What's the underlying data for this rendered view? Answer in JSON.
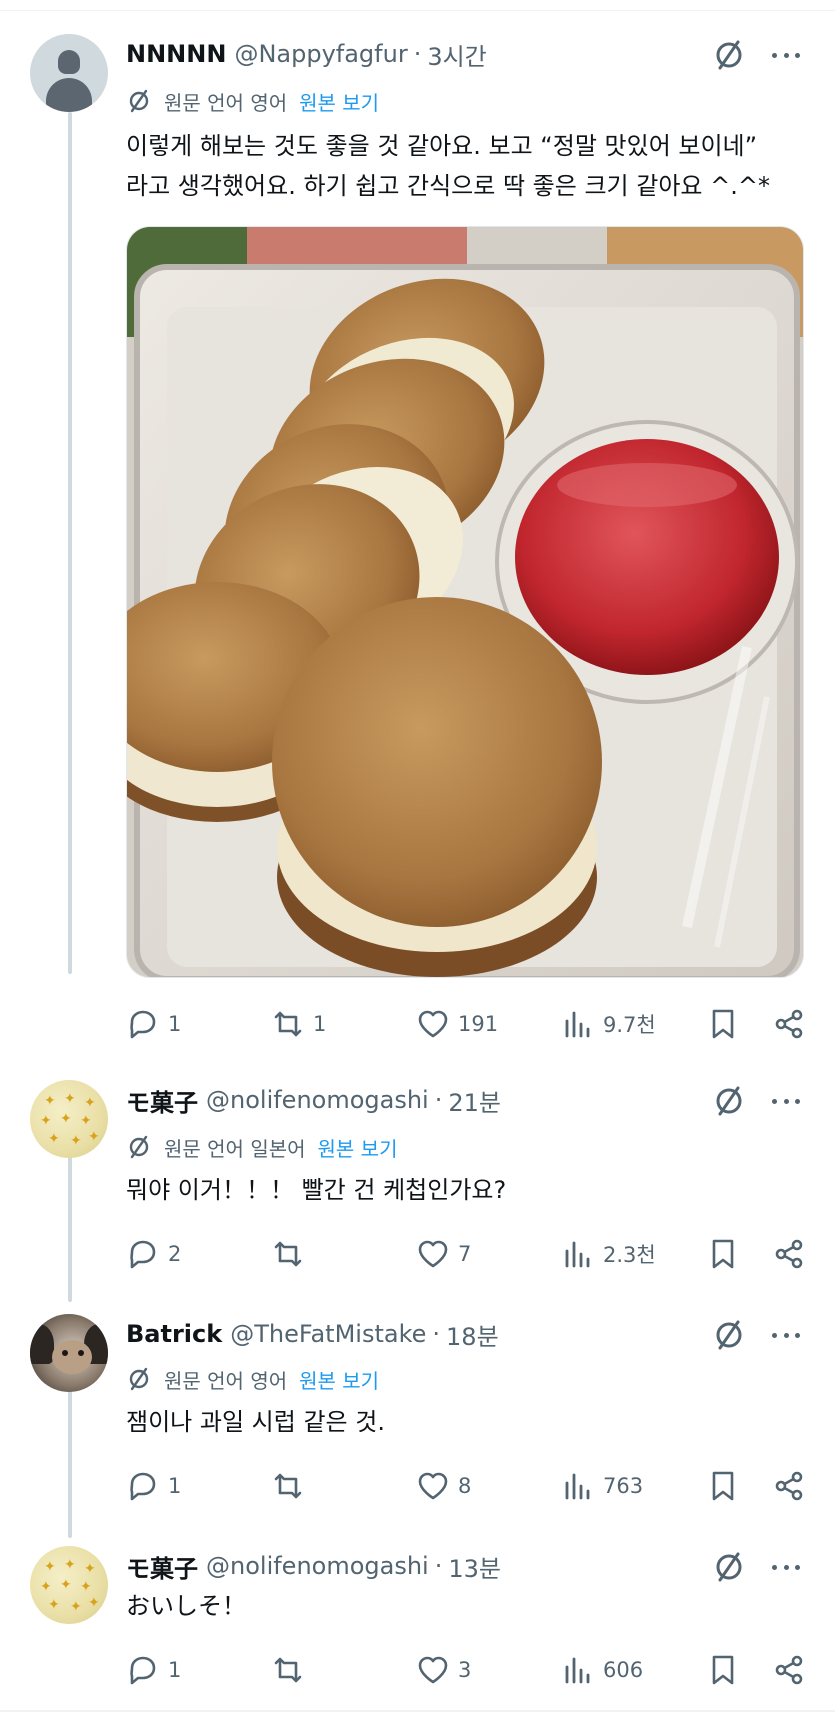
{
  "tweets": [
    {
      "name": "NNNNN",
      "handle": "@Nappyfagfur",
      "time": "3시간",
      "source_lang": "원문 언어 영어",
      "show_original": "원본 보기",
      "text_line1": "이렇게 해보는 것도 좋을 것 같아요. 보고 “정말 맛있어 보이네”",
      "text_line2": "라고 생각했어요. 하기 쉽고 간식으로 딱 좋은 크기 같아요 ^.^*",
      "replies": "1",
      "reposts": "1",
      "likes": "191",
      "views": "9.7천",
      "avatar": "default-avatar"
    },
    {
      "name": "モ菓子",
      "handle": "@nolifenomogashi",
      "time": "21분",
      "source_lang": "원문 언어 일본어",
      "show_original": "원본 보기",
      "text": "뭐야 이거！！！ 빨간 건 케첩인가요?",
      "replies": "2",
      "reposts": "",
      "likes": "7",
      "views": "2.3천",
      "avatar": "mogashi-avatar"
    },
    {
      "name": "Batrick",
      "handle": "@TheFatMistake",
      "time": "18분",
      "source_lang": "원문 언어 영어",
      "show_original": "원본 보기",
      "text": "잼이나 과일 시럽 같은 것.",
      "replies": "1",
      "reposts": "",
      "likes": "8",
      "views": "763",
      "avatar": "bat-avatar"
    },
    {
      "name": "モ菓子",
      "handle": "@nolifenomogashi",
      "time": "13분",
      "text": "おいしそ！",
      "replies": "1",
      "reposts": "",
      "likes": "3",
      "views": "606",
      "avatar": "mogashi-avatar"
    }
  ],
  "separator": "·",
  "colors": {
    "text": "#0f1419",
    "secondary": "#536471",
    "link": "#1d9bf0",
    "thread_line": "#cfd9de"
  },
  "icons": [
    "reply-icon",
    "repost-icon",
    "like-icon",
    "views-icon",
    "bookmark-icon",
    "share-icon",
    "translate-icon",
    "more-icon"
  ]
}
